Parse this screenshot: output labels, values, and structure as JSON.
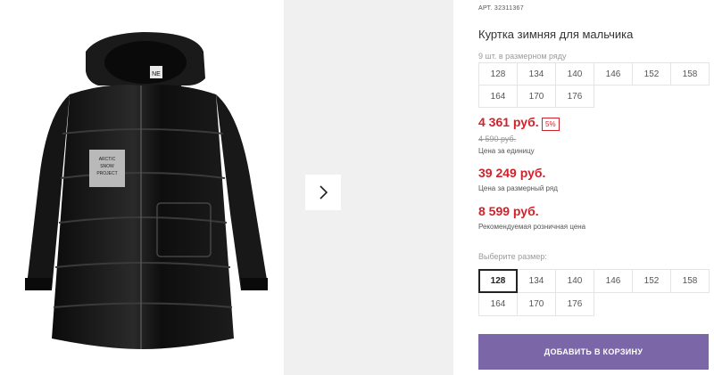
{
  "product": {
    "sku_label": "АРТ.",
    "sku_value": "32311367",
    "title": "Куртка зимняя для мальчика",
    "count_text": "9 шт. в размерном ряду",
    "sizes_info": [
      "128",
      "134",
      "140",
      "146",
      "152",
      "158",
      "164",
      "170",
      "176"
    ],
    "badge_text": "ARCTIC SNOW PROJECT",
    "logo_text": "NE"
  },
  "prices": {
    "unit_price": "4 361 руб.",
    "discount": "5%",
    "old_price": "4 590 руб.",
    "unit_caption": "Цена за единицу",
    "row_price": "39 249 руб.",
    "row_caption": "Цена за размерный ряд",
    "retail_price": "8 599 руб.",
    "retail_caption": "Рекомендуемая розничная цена"
  },
  "size_select": {
    "label": "Выберите размер:",
    "options": [
      "128",
      "134",
      "140",
      "146",
      "152",
      "158",
      "164",
      "170",
      "176"
    ],
    "selected": "128"
  },
  "cart": {
    "add_label": "ДОБАВИТЬ В КОРЗИНУ"
  },
  "icons": {
    "next": "chevron-right-icon"
  },
  "colors": {
    "price": "#d0222b",
    "button": "#7b67a8"
  }
}
